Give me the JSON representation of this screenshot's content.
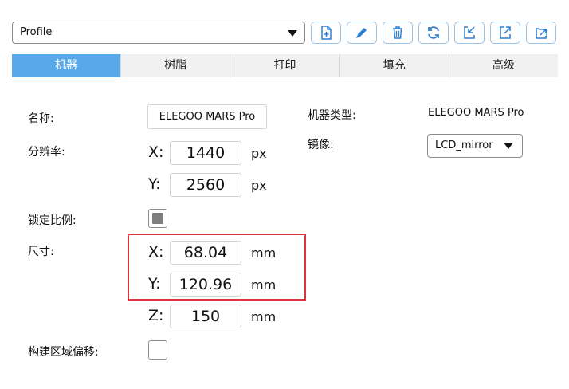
{
  "toolbar": {
    "profile_value": "Profile",
    "buttons": [
      {
        "name": "new-profile-button",
        "icon": "file-plus-icon"
      },
      {
        "name": "edit-profile-button",
        "icon": "pencil-icon"
      },
      {
        "name": "delete-profile-button",
        "icon": "trash-icon"
      },
      {
        "name": "refresh-profile-button",
        "icon": "refresh-icon"
      },
      {
        "name": "import-profile-button",
        "icon": "import-icon"
      },
      {
        "name": "export-profile-button",
        "icon": "export-icon"
      },
      {
        "name": "share-profile-button",
        "icon": "share-icon"
      }
    ]
  },
  "tabs": [
    {
      "label": "机器",
      "active": true
    },
    {
      "label": "树脂",
      "active": false
    },
    {
      "label": "打印",
      "active": false
    },
    {
      "label": "填充",
      "active": false
    },
    {
      "label": "高级",
      "active": false
    }
  ],
  "machine": {
    "name_label": "名称:",
    "name_value": "ELEGOO MARS Pro",
    "type_label": "机器类型:",
    "type_value": "ELEGOO MARS Pro",
    "mirror_label": "镜像:",
    "mirror_value": "LCD_mirror",
    "resolution_label": "分辨率:",
    "resolution": {
      "x_label": "X:",
      "x": "1440",
      "y_label": "Y:",
      "y": "2560",
      "unit": "px"
    },
    "lock_ratio_label": "锁定比例:",
    "lock_ratio_checked": true,
    "size_label": "尺寸:",
    "size": {
      "x_label": "X:",
      "x": "68.04",
      "y_label": "Y:",
      "y": "120.96",
      "z_label": "Z:",
      "z": "150",
      "unit": "mm"
    },
    "build_offset_label": "构建区域偏移:",
    "build_offset_checked": false
  },
  "colors": {
    "accent": "#57a9e7",
    "highlight": "#d9363e",
    "checkbox_fill": "#7f7f7f"
  }
}
